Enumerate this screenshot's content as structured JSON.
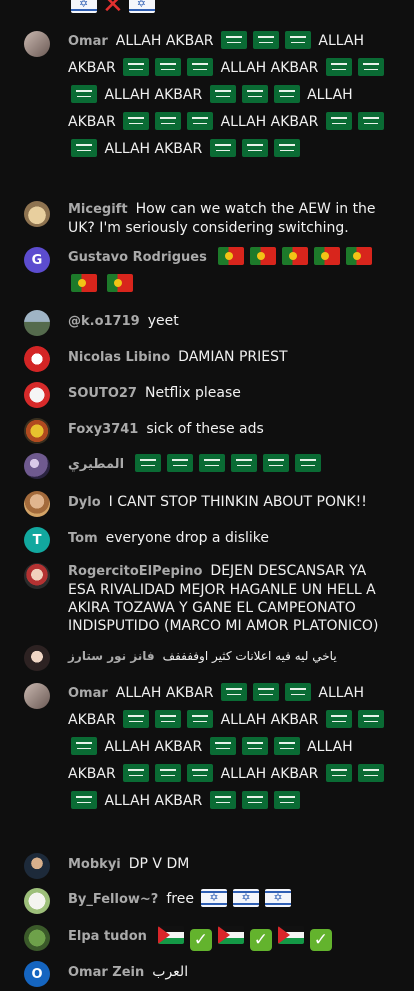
{
  "chat": {
    "partial_top": {
      "emoji": [
        "flag-il",
        "cross-mark",
        "flag-il"
      ]
    },
    "messages": [
      {
        "author": "Omar",
        "text_segments": [
          "ALLAH AKBAR",
          "ALLAH AKBAR",
          "ALLAH AKBAR",
          "ALLAH AKBAR",
          "ALLAH AKBAR",
          "ALLAH AKBAR",
          "ALLAH AKBAR",
          "ALLAH AKBAR"
        ],
        "avatar_icon": "user-photo-avatar"
      },
      {
        "author": "Micegift",
        "text": "How can we watch the AEW in the UK? I'm seriously considering switching.",
        "avatar_icon": "dog-photo-avatar"
      },
      {
        "author": "Gustavo Rodrigues",
        "text": "",
        "avatar_letter": "G",
        "avatar_color": "#5c4ccf",
        "emoji": "flag-portugal x7"
      },
      {
        "author": "@k.o1719",
        "text": "yeet",
        "avatar_icon": "landscape-photo-avatar"
      },
      {
        "author": "Nicolas Libino",
        "text": "DAMIAN PRIEST",
        "avatar_icon": "jersey-photo-avatar"
      },
      {
        "author": "SOUTO27",
        "text": "Netflix please",
        "avatar_icon": "red-logo-avatar"
      },
      {
        "author": "Foxy3741",
        "text": "sick of these ads",
        "avatar_icon": "flower-avatar"
      },
      {
        "author": "المطيري",
        "text": "",
        "avatar_icon": "galaxy-avatar",
        "emoji": "flag-saudi x6"
      },
      {
        "author": "Dylo",
        "text": "I CANT STOP THINKIN ABOUT PONK!!",
        "avatar_icon": "portrait-avatar"
      },
      {
        "author": "Tom",
        "text": "everyone drop a dislike",
        "avatar_letter": "T",
        "avatar_color": "#12a89f"
      },
      {
        "author": "RogercitoElPepino",
        "text": "DEJEN DESCANSAR YA ESA RIVALIDAD MEJOR HAGANLE UN HELL A AKIRA TOZAWA Y GANE EL CAMPEONATO INDISPUTIDO (MARCO MI AMOR PLATONICO)",
        "avatar_icon": "character-avatar"
      },
      {
        "author": "فانز نور ستارز",
        "text": "ياخي ليه فيه اعلانات كثير اوففففف",
        "avatar_icon": "woman-photo-avatar"
      },
      {
        "author": "Omar",
        "text_segments": [
          "ALLAH AKBAR",
          "ALLAH AKBAR",
          "ALLAH AKBAR",
          "ALLAH AKBAR",
          "ALLAH AKBAR",
          "ALLAH AKBAR",
          "ALLAH AKBAR",
          "ALLAH AKBAR"
        ],
        "avatar_icon": "user-photo-avatar"
      },
      {
        "author": "Mobkyi",
        "text": "DP V DM",
        "avatar_icon": "person-avatar"
      },
      {
        "author": "By_Fellow~?",
        "text": "free",
        "avatar_icon": "sticker-avatar",
        "emoji": "flag-israel x3"
      },
      {
        "author": "Elpa tudon",
        "text": "",
        "avatar_icon": "frog-avatar",
        "emoji": "flag-palestine check x3"
      },
      {
        "author": "Omar Zein",
        "text": "العرب",
        "avatar_letter": "O",
        "avatar_color": "#1565c0"
      }
    ]
  }
}
